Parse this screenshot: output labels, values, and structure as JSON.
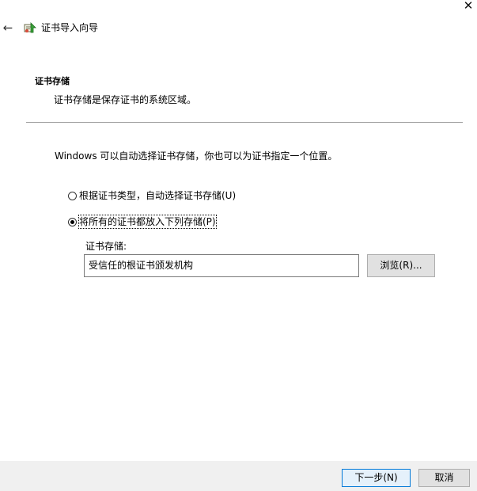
{
  "window": {
    "title": "证书导入向导",
    "close_glyph": "✕",
    "back_glyph": "←",
    "icons": {
      "back": "back-arrow-icon",
      "wizard": "certificate-wizard-icon",
      "close": "close-icon"
    }
  },
  "header": {
    "heading": "证书存储",
    "description": "证书存储是保存证书的系统区域。"
  },
  "main": {
    "intro": "Windows 可以自动选择证书存储，你也可以为证书指定一个位置。",
    "options": [
      {
        "label": "根据证书类型，自动选择证书存储(U)",
        "selected": false
      },
      {
        "label": "将所有的证书都放入下列存储(P)",
        "selected": true
      }
    ],
    "store": {
      "label": "证书存储:",
      "value": "受信任的根证书颁发机构",
      "browse_label": "浏览(R)..."
    }
  },
  "footer": {
    "next_label": "下一步(N)",
    "cancel_label": "取消"
  },
  "colors": {
    "footer_bg": "#f0f0f0",
    "primary_border": "#0078d7",
    "primary_bg": "#e5f1fb",
    "button_bg": "#e1e1e1"
  }
}
